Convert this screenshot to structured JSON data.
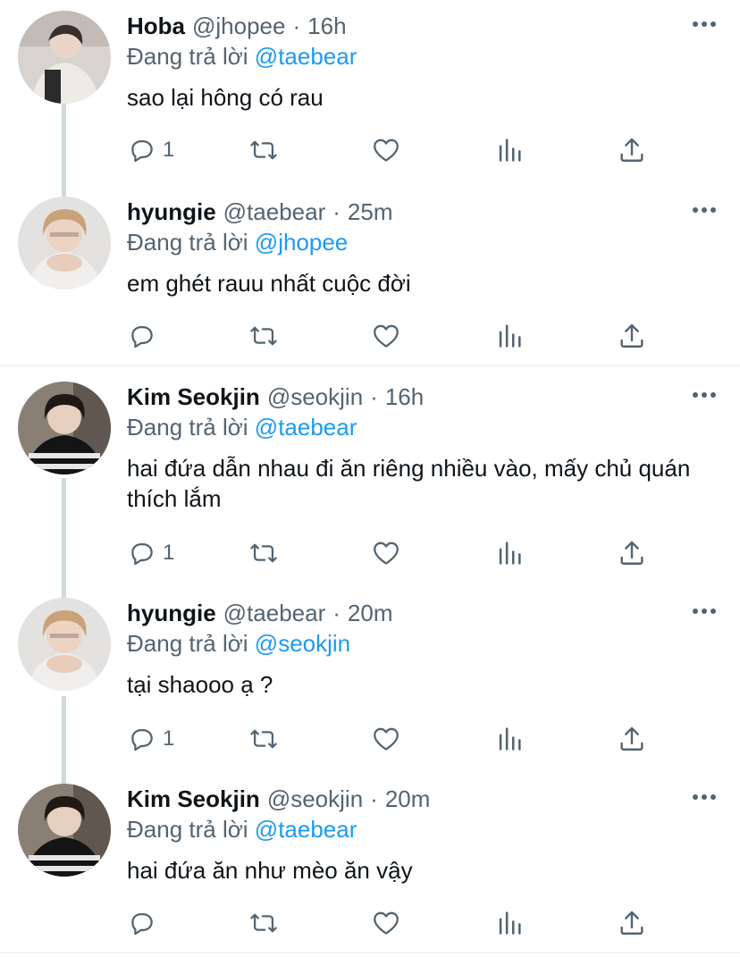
{
  "reply_prefix": "Đang trả lời",
  "tweets": [
    {
      "name": "Hoba",
      "handle": "@jhopee",
      "sep": "·",
      "time": "16h",
      "reply_to": "@taebear",
      "text": "sao lại hông có rau",
      "reply_count": "1"
    },
    {
      "name": "hyungie",
      "handle": "@taebear",
      "sep": "·",
      "time": "25m",
      "reply_to": "@jhopee",
      "text": "em ghét rauu nhất cuộc đời",
      "reply_count": ""
    },
    {
      "name": "Kim Seokjin",
      "handle": "@seokjin",
      "sep": "·",
      "time": "16h",
      "reply_to": "@taebear",
      "text": "hai đứa dẫn nhau đi ăn riêng nhiều vào, mấy chủ quán thích lắm",
      "reply_count": "1"
    },
    {
      "name": "hyungie",
      "handle": "@taebear",
      "sep": "·",
      "time": "20m",
      "reply_to": "@seokjin",
      "text": "tại shaooo ạ ?",
      "reply_count": "1"
    },
    {
      "name": "Kim Seokjin",
      "handle": "@seokjin",
      "sep": "·",
      "time": "20m",
      "reply_to": "@taebear",
      "text": "hai đứa ăn như mèo ăn vậy",
      "reply_count": ""
    }
  ],
  "colors": {
    "text": "#0f1419",
    "secondary": "#536471",
    "link": "#1d9bf0",
    "thread_line": "#cfd9de",
    "divider": "#e6ecf0"
  },
  "icons": [
    "reply-icon",
    "retweet-icon",
    "like-icon",
    "analytics-icon",
    "share-icon",
    "more-options-icon"
  ]
}
